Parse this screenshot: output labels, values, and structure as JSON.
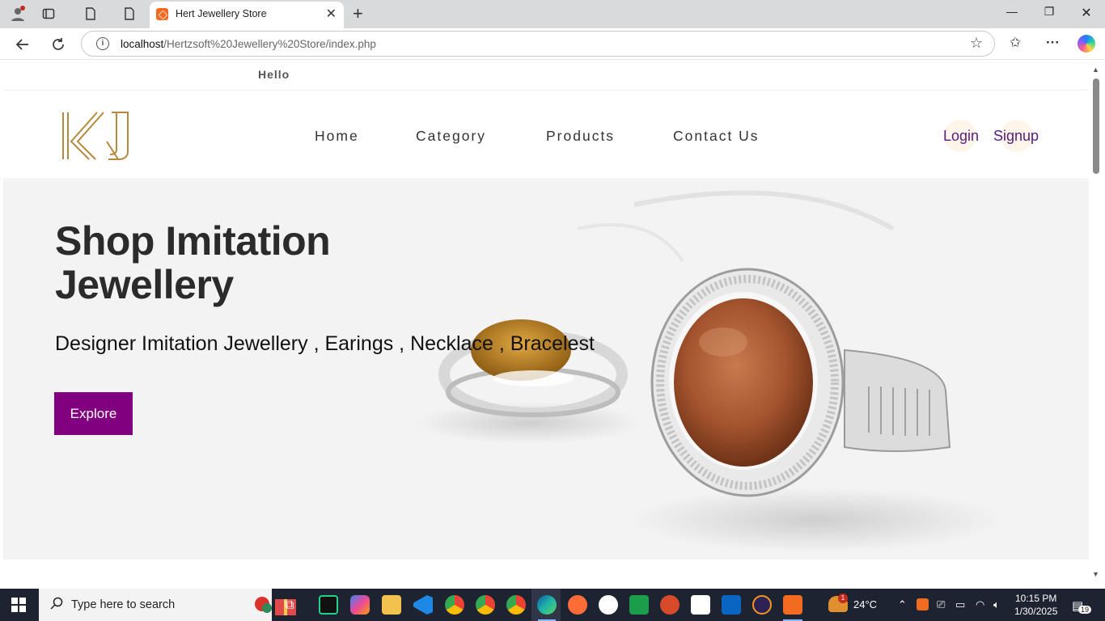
{
  "browser": {
    "tab_title": "Hert Jewellery Store",
    "url_host": "localhost",
    "url_path": "/Hertzsoft%20Jewellery%20Store/index.php"
  },
  "site": {
    "top_message": "Hello",
    "logo_text": "KJ",
    "nav": [
      "Home",
      "Category",
      "Products",
      "Contact Us"
    ],
    "login": "Login",
    "signup": "Signup",
    "hero": {
      "title_line1": "Shop Imitation",
      "title_line2": "Jewellery",
      "subtitle": "Designer Imitation Jewellery , Earings , Necklace , Bracelest",
      "button": "Explore"
    },
    "colors": {
      "accent": "#800080",
      "auth_text": "#5a1a7a",
      "logo_gold": "#b5893e"
    }
  },
  "taskbar": {
    "search_placeholder": "Type here to search",
    "weather": "24°C",
    "time": "10:15 PM",
    "date": "1/30/2025",
    "notifications": "19",
    "weather_badge": "1"
  }
}
